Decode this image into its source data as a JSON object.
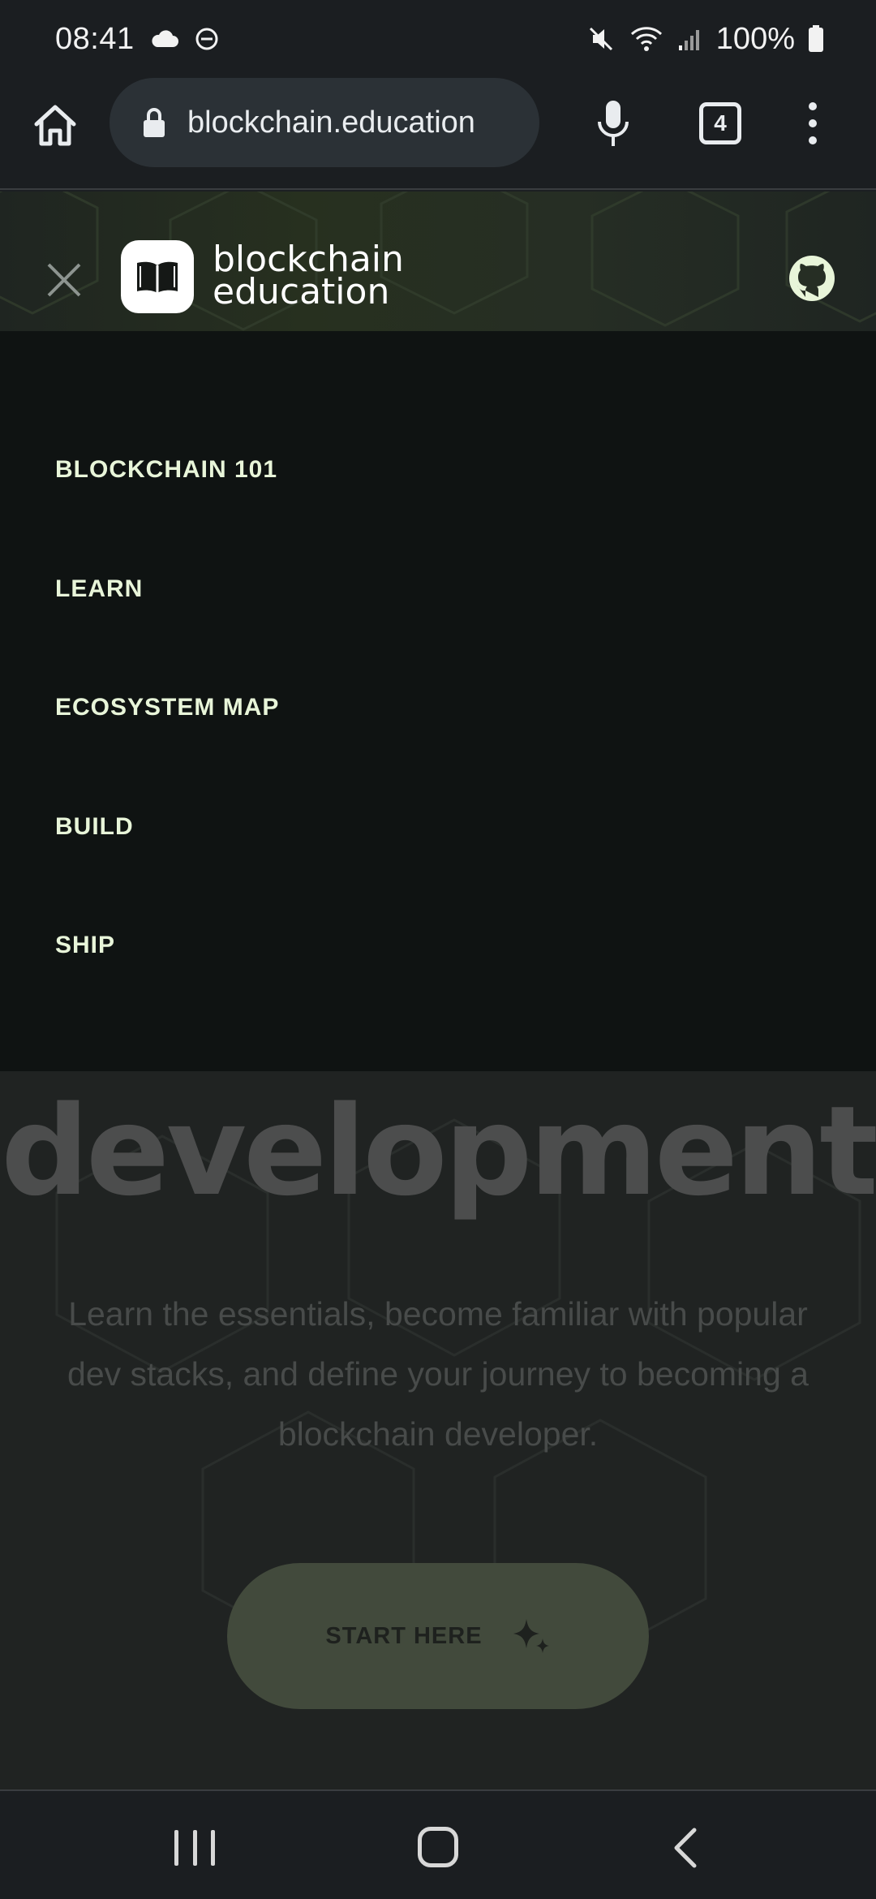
{
  "status_bar": {
    "time": "08:41",
    "battery": "100%",
    "icons": [
      "cloud-icon",
      "dnd-icon",
      "mute-icon",
      "wifi-icon",
      "signal-icon",
      "battery-icon"
    ]
  },
  "browser": {
    "url": "blockchain.education",
    "tab_count": "4"
  },
  "site": {
    "logo_line1": "blockchain",
    "logo_line2": "education"
  },
  "menu": {
    "items": [
      {
        "label": "BLOCKCHAIN 101"
      },
      {
        "label": "LEARN"
      },
      {
        "label": "ECOSYSTEM MAP"
      },
      {
        "label": "BUILD"
      },
      {
        "label": "SHIP"
      }
    ]
  },
  "hero": {
    "title": "development",
    "description": "Learn the essentials, become familiar with popular dev stacks, and define your journey to becoming a blockchain developer.",
    "cta": "START HERE"
  },
  "colors": {
    "menu_text": "#e8f5d9",
    "menu_bg": "#0f1312",
    "header_accent": "#27301f"
  }
}
